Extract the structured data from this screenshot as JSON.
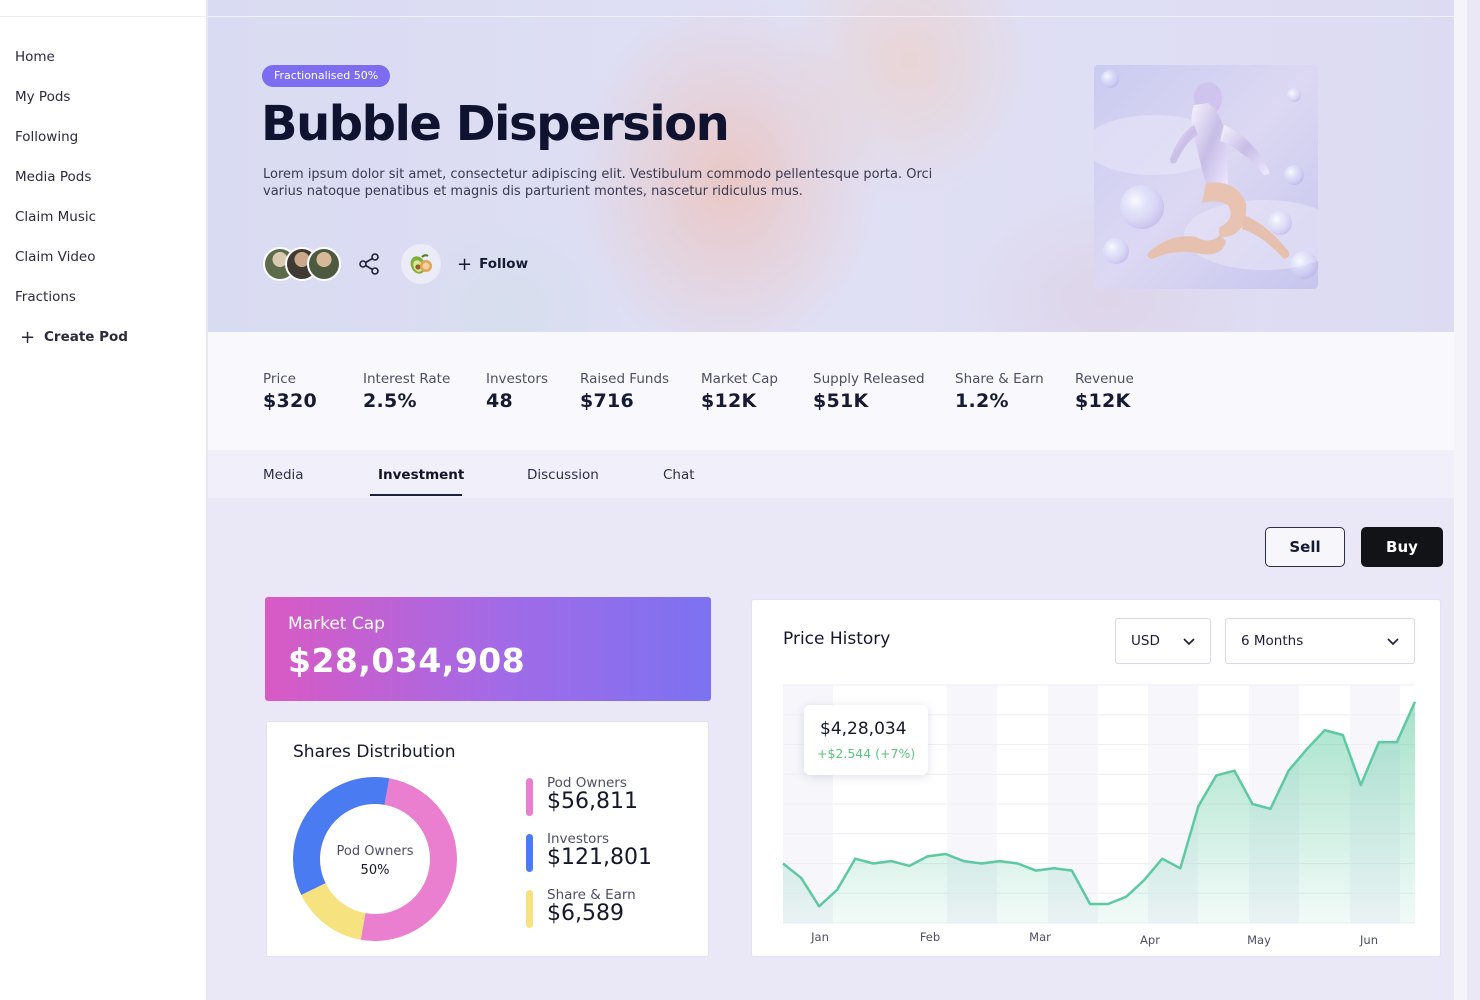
{
  "sidebar": {
    "items": [
      {
        "label": "Home"
      },
      {
        "label": "My Pods"
      },
      {
        "label": "Following"
      },
      {
        "label": "Media Pods"
      },
      {
        "label": "Claim Music"
      },
      {
        "label": "Claim Video"
      },
      {
        "label": "Fractions"
      }
    ],
    "create_label": "Create Pod"
  },
  "hero": {
    "badge": "Fractionalised 50%",
    "title": "Bubble Dispersion",
    "description": "Lorem ipsum dolor sit amet, consectetur adipiscing elit. Vestibulum commodo pellentesque porta. Orci varius natoque penatibus et magnis dis parturient montes, nascetur ridiculus mus.",
    "follow_label": "Follow"
  },
  "stats": [
    {
      "label": "Price",
      "value": "$320"
    },
    {
      "label": "Interest Rate",
      "value": "2.5%"
    },
    {
      "label": "Investors",
      "value": "48"
    },
    {
      "label": "Raised Funds",
      "value": "$716"
    },
    {
      "label": "Market Cap",
      "value": "$12K"
    },
    {
      "label": "Supply Released",
      "value": "$51K"
    },
    {
      "label": "Share & Earn",
      "value": "1.2%"
    },
    {
      "label": "Revenue",
      "value": "$12K"
    }
  ],
  "tabs": [
    {
      "label": "Media"
    },
    {
      "label": "Investment",
      "active": true
    },
    {
      "label": "Discussion"
    },
    {
      "label": "Chat"
    }
  ],
  "actions": {
    "sell_label": "Sell",
    "buy_label": "Buy"
  },
  "market_cap": {
    "label": "Market Cap",
    "value": "$28,034,908"
  },
  "shares": {
    "title": "Shares Distribution",
    "center_label": "Pod Owners",
    "center_value": "50%",
    "segments": [
      {
        "name": "Pod Owners",
        "percent": 50,
        "color": "#ea7fcf"
      },
      {
        "name": "Share & Earn",
        "percent": 15,
        "color": "#f6e27f"
      },
      {
        "name": "Investors",
        "percent": 35,
        "color": "#4b7bf0"
      }
    ],
    "legend": [
      {
        "label": "Pod Owners",
        "value": "$56,811",
        "color": "#ea7fcf"
      },
      {
        "label": "Investors",
        "value": "$121,801",
        "color": "#4b7bf0"
      },
      {
        "label": "Share & Earn",
        "value": "$6,589",
        "color": "#f6e27f"
      }
    ]
  },
  "price_history": {
    "title": "Price History",
    "currency": "USD",
    "range": "6 Months",
    "tooltip_value": "$4,28,034",
    "tooltip_change": "+$2.544 (+7%)"
  },
  "chart_data": {
    "type": "area",
    "title": "Price History",
    "x_labels": [
      "Jan",
      "Feb",
      "Mar",
      "Apr",
      "May",
      "Jun"
    ],
    "y_relative": [
      0.25,
      0.19,
      0.07,
      0.14,
      0.27,
      0.25,
      0.26,
      0.24,
      0.28,
      0.29,
      0.26,
      0.25,
      0.26,
      0.25,
      0.22,
      0.23,
      0.22,
      0.08,
      0.08,
      0.11,
      0.18,
      0.27,
      0.23,
      0.49,
      0.62,
      0.64,
      0.5,
      0.48,
      0.64,
      0.73,
      0.81,
      0.79,
      0.58,
      0.76,
      0.76,
      0.93
    ],
    "color": "#5dc9a1",
    "legend": "none",
    "grid": true
  }
}
